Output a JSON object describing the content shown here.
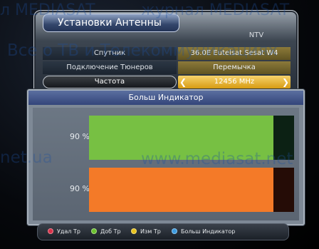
{
  "window": {
    "title": "Установки Антенны",
    "satellite_name": "NTV"
  },
  "rows": [
    {
      "label": "Спутник",
      "value": "36.0E Eutelsat Sesat W4"
    },
    {
      "label": "Подключение Тюнеров",
      "value": "Перемычка"
    },
    {
      "label": "Частота",
      "value": "12456 MHz"
    }
  ],
  "indicator": {
    "title": "Больш Индикатор",
    "bars": [
      {
        "label": "90 %",
        "level_percent": 90,
        "color": "#77c043"
      },
      {
        "label": "90 %",
        "level_percent": 90,
        "color": "#f47a28"
      }
    ]
  },
  "footer": [
    {
      "label": "Удал Тр",
      "color": "#d8324a",
      "icon": "red-button-icon"
    },
    {
      "label": "Доб Тр",
      "color": "#6cc12e",
      "icon": "green-button-icon"
    },
    {
      "label": "Изм Тр",
      "color": "#e7c21d",
      "icon": "yellow-button-icon"
    },
    {
      "label": "Больш Индикатор",
      "color": "#3c9be0",
      "icon": "blue-button-icon"
    }
  ],
  "watermark": [
    "л MEDIASAT",
    "журнал MEDIASAT",
    "Все о ТВ и Телекоммуникациях",
    "net.ua",
    "www.mediasat.net"
  ]
}
